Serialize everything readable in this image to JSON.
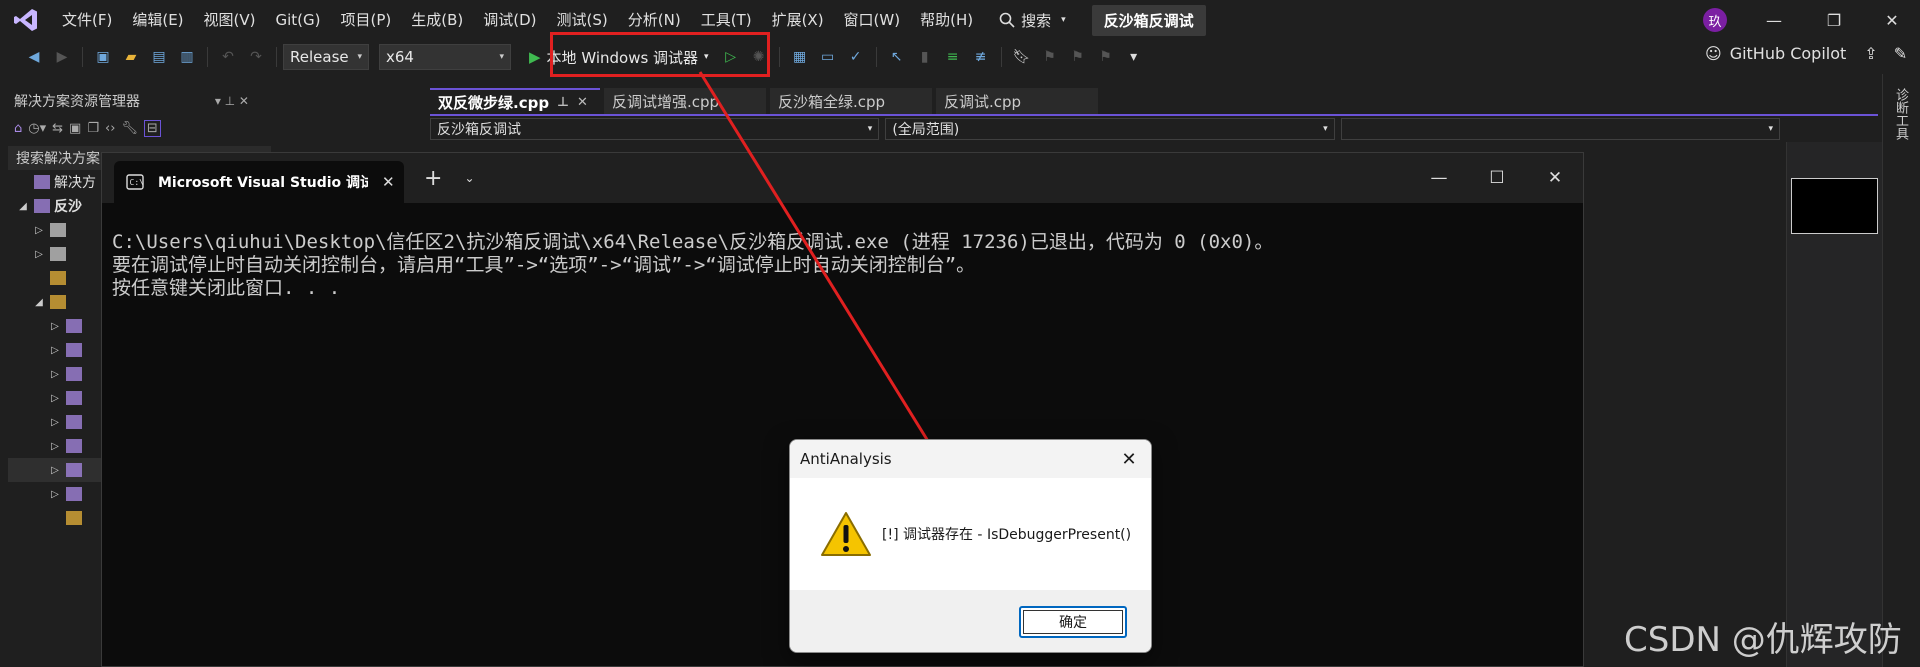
{
  "menu": {
    "items": [
      "文件(F)",
      "编辑(E)",
      "视图(V)",
      "Git(G)",
      "项目(P)",
      "生成(B)",
      "调试(D)",
      "测试(S)",
      "分析(N)",
      "工具(T)",
      "扩展(X)",
      "窗口(W)",
      "帮助(H)"
    ],
    "search_label": "搜索",
    "solution_title": "反沙箱反调试",
    "avatar_initial": "玖"
  },
  "toolbar": {
    "configuration": "Release",
    "platform": "x64",
    "run_label": "本地 Windows 调试器",
    "copilot_label": "GitHub Copilot"
  },
  "solution_explorer": {
    "title": "解决方案资源管理器",
    "search_placeholder": "搜索解决方案",
    "root_label": "解决方",
    "project_label": "反沙"
  },
  "editor": {
    "tabs": [
      {
        "label": "双反微步绿.cpp",
        "active": true
      },
      {
        "label": "反调试增强.cpp",
        "active": false
      },
      {
        "label": "反沙箱全绿.cpp",
        "active": false
      },
      {
        "label": "反调试.cpp",
        "active": false
      }
    ],
    "nav_project": "反沙箱反调试",
    "nav_scope": "(全局范围)",
    "right_panel_label": "诊断工具"
  },
  "console": {
    "tab_title": "Microsoft Visual Studio 调试控制台",
    "lines": [
      "C:\\Users\\qiuhui\\Desktop\\信任区2\\抗沙箱反调试\\x64\\Release\\反沙箱反调试.exe (进程 17236)已退出，代码为 0 (0x0)。",
      "要在调试停止时自动关闭控制台，请启用“工具”->“选项”->“调试”->“调试停止时自动关闭控制台”。",
      "按任意键关闭此窗口. . ."
    ]
  },
  "dialog": {
    "title": "AntiAnalysis",
    "message": "[!] 调试器存在 - IsDebuggerPresent()",
    "ok_label": "确定"
  },
  "watermark": "CSDN @仇辉攻防",
  "colors": {
    "accent": "#6b53d6",
    "highlight": "#e02020",
    "run": "#3fb950"
  }
}
